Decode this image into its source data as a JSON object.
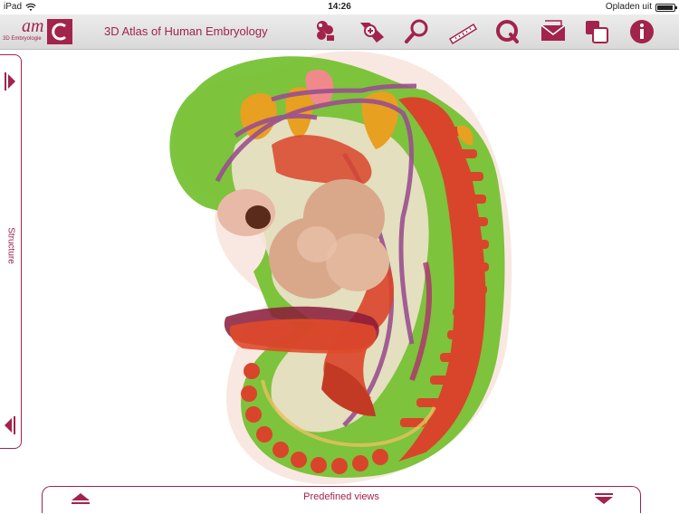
{
  "status_bar": {
    "device": "iPad",
    "time": "14:26",
    "battery_label": "Opladen uit"
  },
  "header": {
    "logo_text": "am",
    "logo_subtext": "3D Embryologie",
    "title": "3D Atlas of Human Embryology"
  },
  "toolbar": {
    "icons": [
      "structures-icon",
      "add-label-icon",
      "search-icon",
      "ruler-icon",
      "quiz-icon",
      "mail-icon",
      "layers-icon",
      "info-icon"
    ]
  },
  "side_panel": {
    "label": "Structure"
  },
  "bottom_panel": {
    "label": "Predefined views"
  },
  "colors": {
    "brand": "#a2234b",
    "toolbar_bg": "#dddddd",
    "skin_green": "#6fbf2a",
    "tissue_red": "#d9452a",
    "tissue_orange": "#e8a020",
    "vessel_purple": "#9b4f8f",
    "heart_beige": "#d9a88a"
  }
}
